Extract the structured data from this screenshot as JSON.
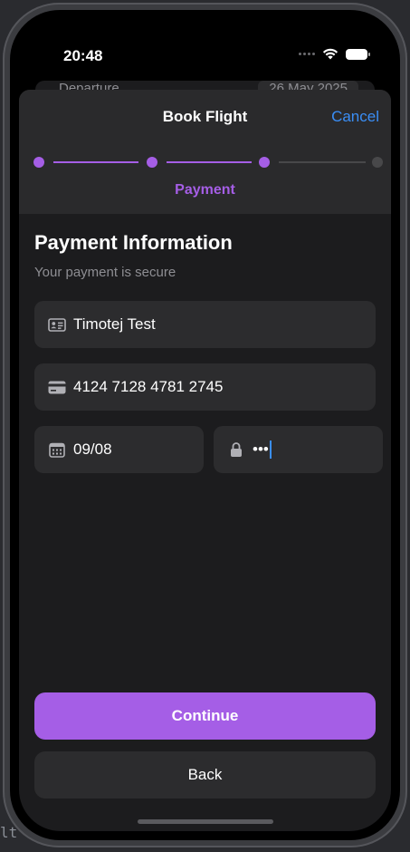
{
  "status_bar": {
    "time": "20:48"
  },
  "background_card": {
    "label": "Departure",
    "value": "26 May 2025"
  },
  "background_terminal": {
    "text": "lt"
  },
  "sheet": {
    "title": "Book Flight",
    "cancel_label": "Cancel",
    "current_step_label": "Payment",
    "steps_total": 4,
    "current_step": 3
  },
  "payment": {
    "heading": "Payment Information",
    "subheading": "Your payment is secure",
    "cardholder_name": "Timotej Test",
    "card_number": "4124 7128 4781 2745",
    "expiry": "09/08",
    "cvv_masked": "•••"
  },
  "buttons": {
    "continue": "Continue",
    "back": "Back"
  },
  "colors": {
    "accent": "#a55ee6",
    "link": "#3a8ef6",
    "field_bg": "#2c2c2e",
    "sheet_bg": "#1c1c1e",
    "inactive_step": "#48484a"
  },
  "icons": {
    "name_field": "id-card-icon",
    "card_field": "credit-card-icon",
    "expiry_field": "calendar-icon",
    "cvv_field": "lock-icon"
  }
}
